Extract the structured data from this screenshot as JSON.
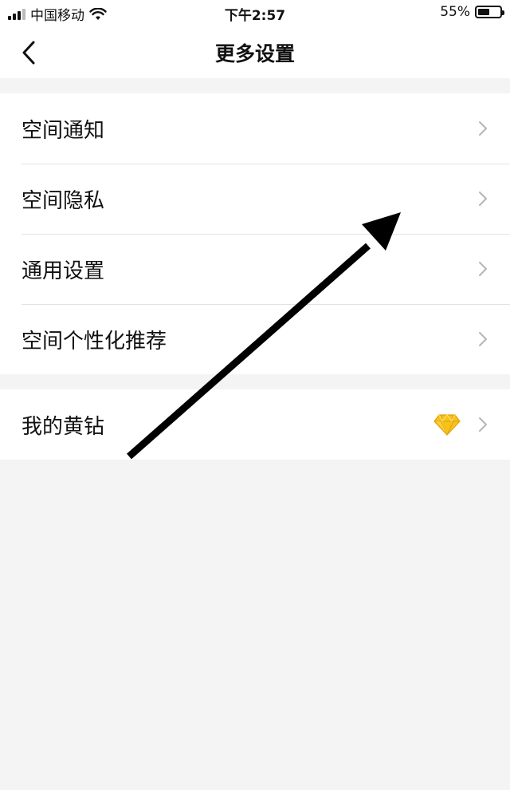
{
  "status_bar": {
    "carrier": "中国移动",
    "time": "下午2:57",
    "battery": "55%",
    "battery_level": 0.55,
    "icons": [
      "signal-icon",
      "wifi-icon",
      "battery-icon"
    ]
  },
  "navbar": {
    "title": "更多设置",
    "back_icon": "chevron-left-icon"
  },
  "settings_group_1": {
    "items": [
      {
        "label": "空间通知"
      },
      {
        "label": "空间隐私"
      },
      {
        "label": "通用设置"
      },
      {
        "label": "空间个性化推荐"
      }
    ]
  },
  "settings_group_2": {
    "items": [
      {
        "label": "我的黄钻",
        "badge_icon": "yellow-diamond-icon"
      }
    ]
  },
  "colors": {
    "background": "#f4f4f4",
    "surface": "#ffffff",
    "divider": "#e2e2e2",
    "chevron": "#b5b5b5",
    "diamond": "#f7c21a"
  }
}
